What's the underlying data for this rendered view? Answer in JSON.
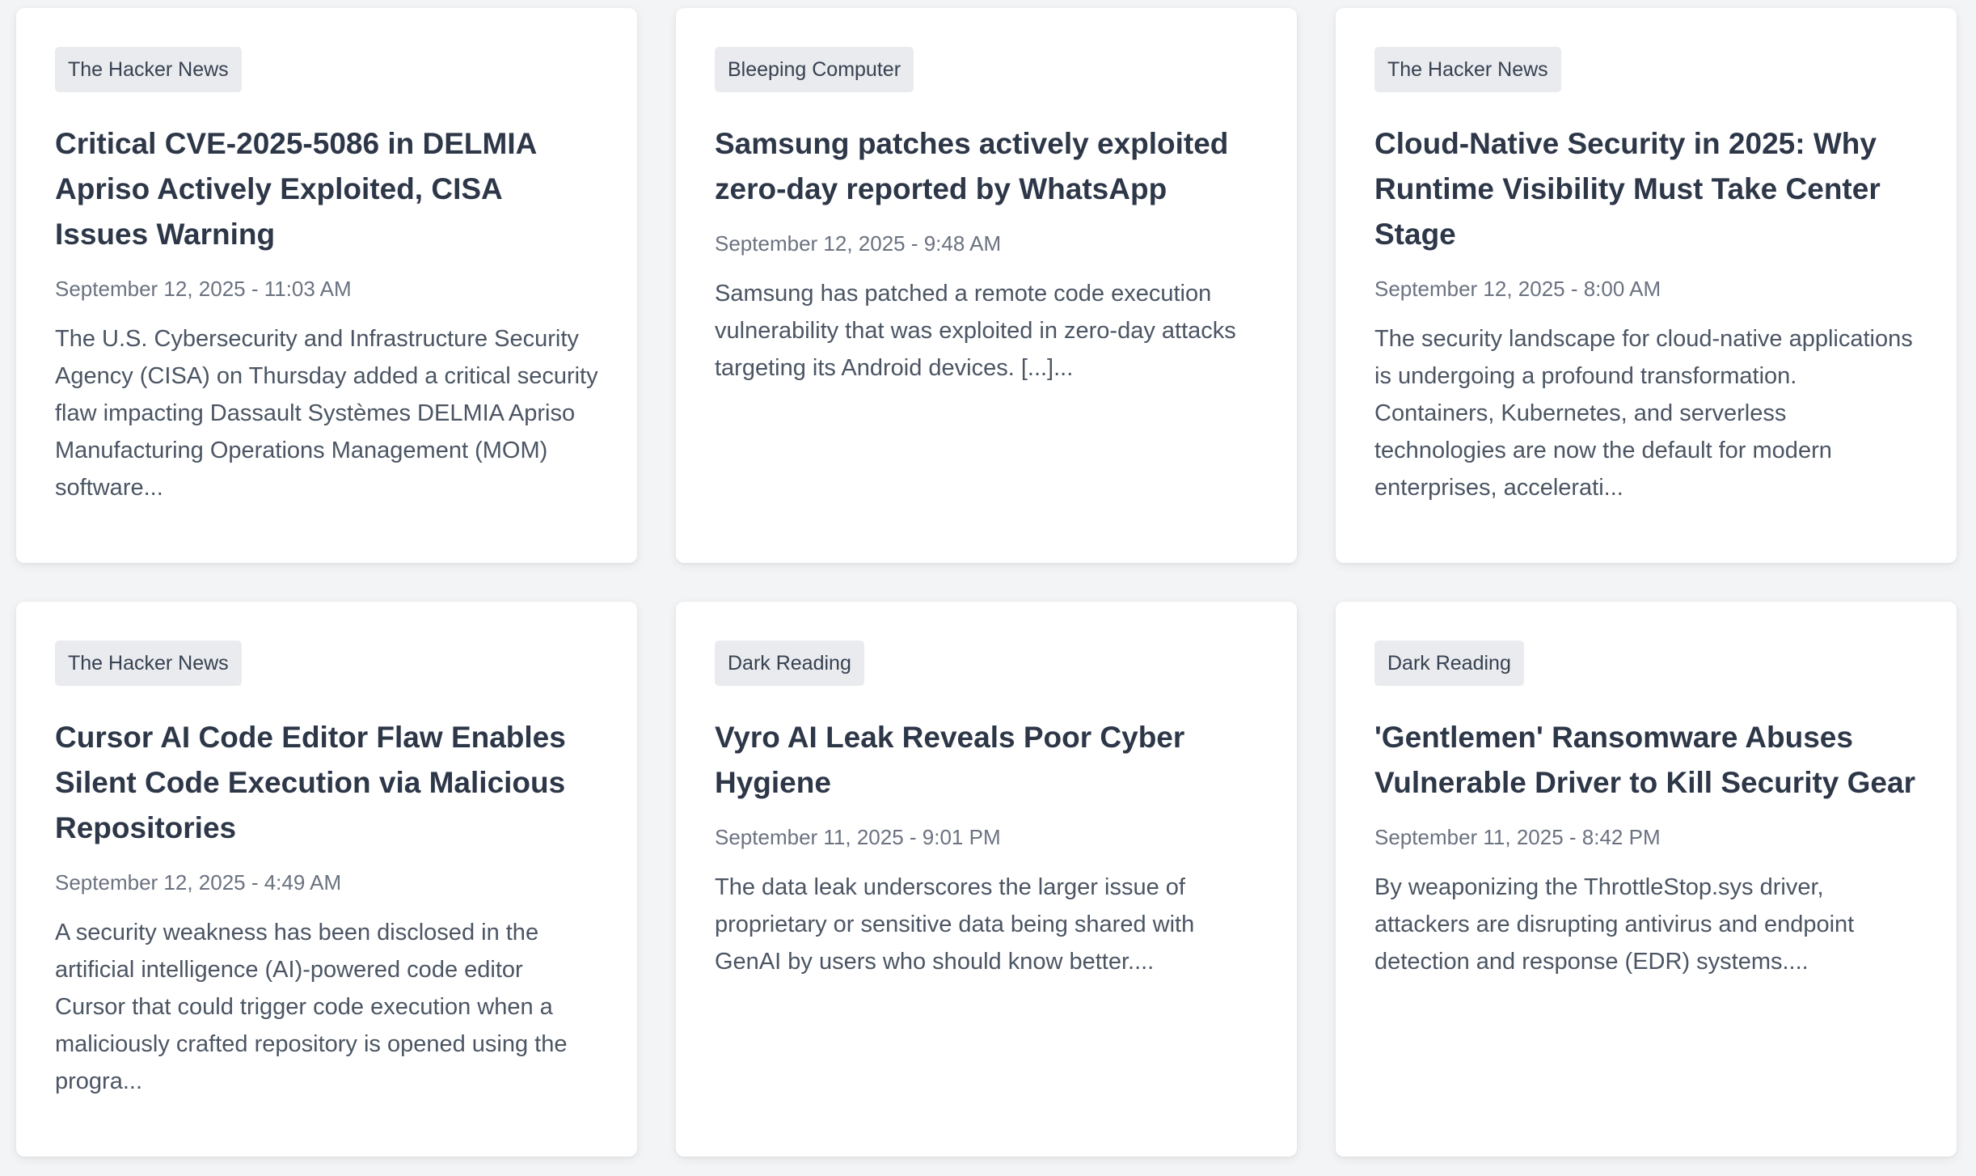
{
  "articles": [
    {
      "source": "The Hacker News",
      "title": "Critical CVE-2025-5086 in DELMIA Apriso Actively Exploited, CISA Issues Warning",
      "date": "September 12, 2025 - 11:03 AM",
      "excerpt": "The U.S. Cybersecurity and Infrastructure Security Agency (CISA) on Thursday added a critical security flaw impacting Dassault Systèmes DELMIA Apriso Manufacturing Operations Management (MOM) software..."
    },
    {
      "source": "Bleeping Computer",
      "title": "Samsung patches actively exploited zero-day reported by WhatsApp",
      "date": "September 12, 2025 - 9:48 AM",
      "excerpt": "Samsung has patched a remote code execution vulnerability that was exploited in zero-day attacks targeting its Android devices. [...]..."
    },
    {
      "source": "The Hacker News",
      "title": "Cloud-Native Security in 2025: Why Runtime Visibility Must Take Center Stage",
      "date": "September 12, 2025 - 8:00 AM",
      "excerpt": "The security landscape for cloud-native applications is undergoing a profound transformation. Containers, Kubernetes, and serverless technologies are now the default for modern enterprises, accelerati..."
    },
    {
      "source": "The Hacker News",
      "title": "Cursor AI Code Editor Flaw Enables Silent Code Execution via Malicious Repositories",
      "date": "September 12, 2025 - 4:49 AM",
      "excerpt": "A security weakness has been disclosed in the artificial intelligence (AI)-powered code editor Cursor that could trigger code execution when a maliciously crafted repository is opened using the progra..."
    },
    {
      "source": "Dark Reading",
      "title": "Vyro AI Leak Reveals Poor Cyber Hygiene",
      "date": "September 11, 2025 - 9:01 PM",
      "excerpt": "The data leak underscores the larger issue of proprietary or sensitive data being shared with GenAI by users who should know better...."
    },
    {
      "source": "Dark Reading",
      "title": "'Gentlemen' Ransomware Abuses Vulnerable Driver to Kill Security Gear",
      "date": "September 11, 2025 - 8:42 PM",
      "excerpt": "By weaponizing the ThrottleStop.sys driver, attackers are disrupting antivirus and endpoint detection and response (EDR) systems...."
    }
  ]
}
